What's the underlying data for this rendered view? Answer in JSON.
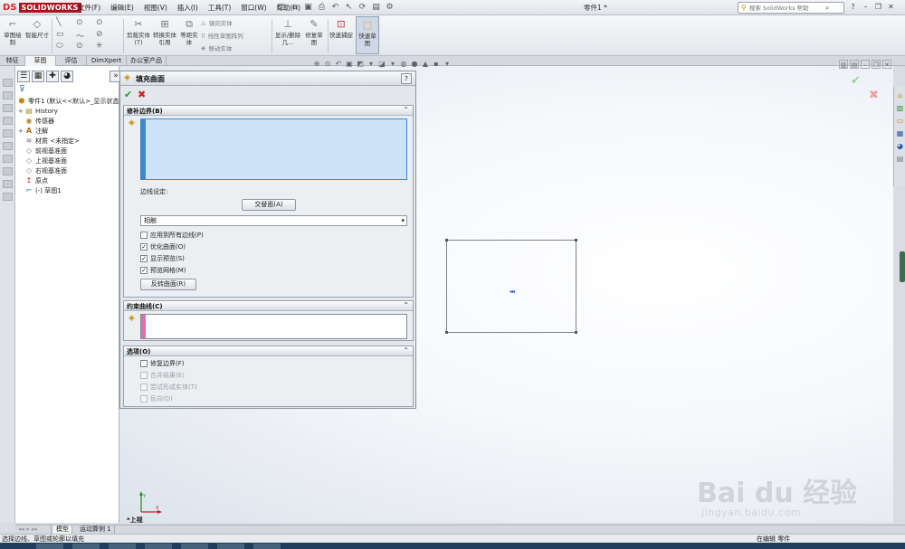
{
  "app": {
    "logo_ds": "DS",
    "logo_text": "SOLIDWORKS",
    "doc_title": "零件1 *",
    "menus": [
      "文件(F)",
      "编辑(E)",
      "视图(V)",
      "插入(I)",
      "工具(T)",
      "窗口(W)",
      "帮助(H)"
    ],
    "search_placeholder": "搜索 SolidWorks 帮助"
  },
  "command_manager": {
    "sketch": "草图绘制",
    "smart_dim": "智能尺寸",
    "trim": "剪裁实体(T)",
    "convert": "转换实体引用",
    "offset": "等距实体",
    "mirror": "镜向实体",
    "pattern": "线性草图阵列",
    "move": "移动实体",
    "display_delete": "显示/删除几...",
    "repair": "修复草图",
    "quick_snap": "快速捕捉",
    "rapid_sketch": "快速草图"
  },
  "tabs": [
    "特征",
    "草图",
    "评估",
    "DimXpert",
    "办公室产品"
  ],
  "tabs_active": 1,
  "feature_tree": {
    "root": "零件1 (默认<<默认>_显示状态",
    "items": [
      {
        "label": "History",
        "icon": "📁",
        "pm": "+"
      },
      {
        "label": "传感器",
        "icon": "📁",
        "pm": ""
      },
      {
        "label": "注解",
        "icon": "A",
        "pm": "+"
      },
      {
        "label": "材质 <未指定>",
        "icon": "≋",
        "pm": ""
      },
      {
        "label": "前视基准面",
        "icon": "◇",
        "pm": ""
      },
      {
        "label": "上视基准面",
        "icon": "◇",
        "pm": ""
      },
      {
        "label": "右视基准面",
        "icon": "◇",
        "pm": ""
      },
      {
        "label": "原点",
        "icon": "↥",
        "pm": ""
      },
      {
        "label": "(-) 草图1",
        "icon": "⌐",
        "pm": ""
      }
    ]
  },
  "property_manager": {
    "title": "填充曲面",
    "help": "?",
    "group_patch_boundary": "修补边界(B)",
    "edge_settings": "边线设定:",
    "alternate_face": "交替面(A)",
    "contact_option": "相触",
    "apply_all_edges": "应用到所有边线(P)",
    "optimize_surface": "优化曲面(O)",
    "show_preview": "显示预览(S)",
    "preview_mesh": "预览网格(M)",
    "reverse_surface": "反转曲面(R)",
    "group_constraint_curves": "约束曲线(C)",
    "group_options": "选项(O)",
    "fix_boundary": "修复边界(F)",
    "merge_result": "合并结果(E)",
    "try_solid": "尝试形成实体(T)",
    "reverse_dir": "反向(D)"
  },
  "graphics": {
    "view_label": "*上视",
    "triad_x": "X",
    "triad_y": "Y"
  },
  "bottom_tabs": [
    "模型",
    "运动算例 1"
  ],
  "status": {
    "left": "选择边线、草图或轮廓以填充",
    "mode": "在编辑 零件"
  },
  "watermark": {
    "main": "Bai du 经验",
    "sub": "jingyan.baidu.com"
  },
  "colors": {
    "accent_blue": "#3c88d4",
    "ok_green": "#2c9a2c",
    "cancel_red": "#d02020",
    "constraint_pink": "#e06fb2"
  }
}
